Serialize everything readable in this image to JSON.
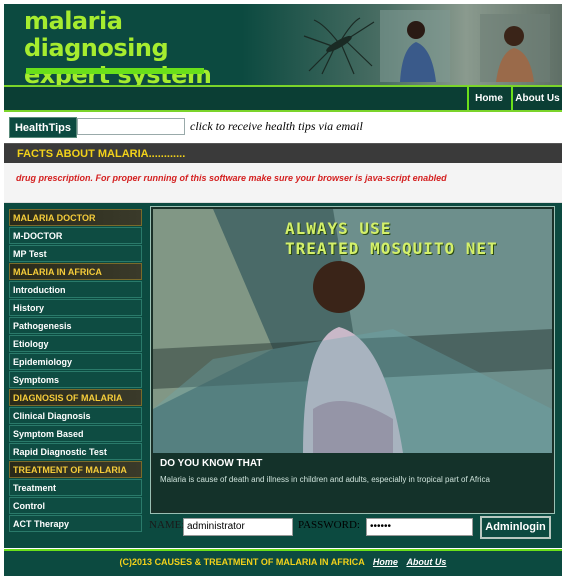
{
  "header": {
    "title_line1": "malaria diagnosing",
    "title_line2": "expert system"
  },
  "nav": {
    "home": "Home",
    "about": "About Us"
  },
  "health_tips": {
    "button_label": "HealthTips",
    "email_value": "",
    "prompt": "click to receive health tips via email"
  },
  "facts": {
    "title": "FACTS ABOUT MALARIA............",
    "marquee": "drug prescription. For proper running of this software make sure your browser is java-script enabled"
  },
  "sidebar": {
    "items": [
      {
        "label": "MALARIA DOCTOR",
        "type": "heading"
      },
      {
        "label": "M-DOCTOR",
        "type": "link"
      },
      {
        "label": "MP Test",
        "type": "link"
      },
      {
        "label": "MALARIA IN AFRICA",
        "type": "heading"
      },
      {
        "label": "Introduction",
        "type": "link"
      },
      {
        "label": "History",
        "type": "link"
      },
      {
        "label": "Pathogenesis",
        "type": "link"
      },
      {
        "label": "Etiology",
        "type": "link"
      },
      {
        "label": "Epidemiology",
        "type": "link"
      },
      {
        "label": "Symptoms",
        "type": "link"
      },
      {
        "label": "DIAGNOSIS OF MALARIA",
        "type": "heading"
      },
      {
        "label": "Clinical Diagnosis",
        "type": "link"
      },
      {
        "label": "Symptom Based",
        "type": "link"
      },
      {
        "label": "Rapid Diagnostic Test",
        "type": "link"
      },
      {
        "label": "TREATMENT OF MALARIA",
        "type": "heading"
      },
      {
        "label": "Treatment",
        "type": "link"
      },
      {
        "label": "Control",
        "type": "link"
      },
      {
        "label": "ACT Therapy",
        "type": "link"
      }
    ]
  },
  "banner": {
    "line1": "ALWAYS USE",
    "line2": "TREATED MOSQUITO NET"
  },
  "did_you_know": {
    "title": "DO YOU KNOW THAT",
    "text": "Malaria is cause of death and illness in children and adults, especially in tropical part of Africa"
  },
  "login": {
    "name_label": "NAME:",
    "name_value": "administrator",
    "password_label": "PASSWORD:",
    "password_value": "••••••",
    "button_label": "Adminlogin"
  },
  "footer": {
    "copyright": "(C)2013 CAUSES & TREATMENT OF MALARIA IN AFRICA",
    "home_link": "Home",
    "about_link": "About Us"
  },
  "colors": {
    "primary_green": "#0c4a40",
    "accent_lime": "#6ae01a",
    "heading_yellow": "#f3d21a",
    "alert_red": "#d42020"
  }
}
